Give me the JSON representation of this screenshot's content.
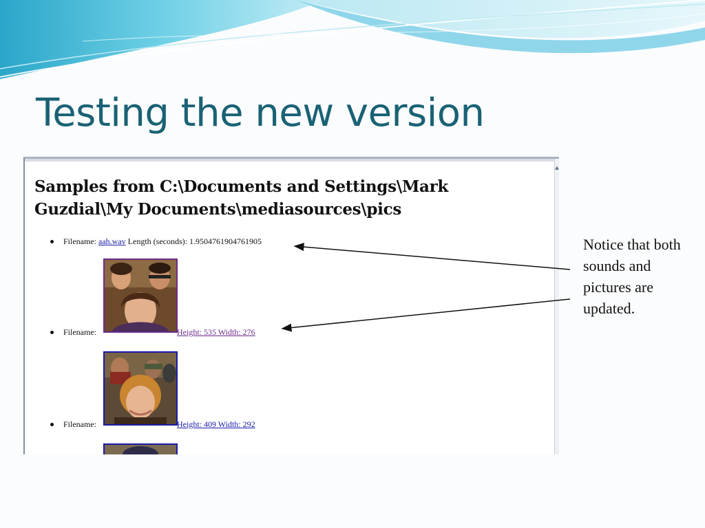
{
  "slide": {
    "title": "Testing the new version",
    "note": "Notice that both sounds and pictures are updated."
  },
  "browser_page": {
    "heading": "Samples from C:\\Documents and Settings\\Mark Guzdial\\My Documents\\mediasources\\pics",
    "entries": [
      {
        "label": "Filename:",
        "link_text": "aah.wav",
        "detail": "Length (seconds): 1.9504761904761905"
      },
      {
        "label": "Filename:",
        "link_text": "Height: 535 Width: 276",
        "image": "group-photo-thumbnail"
      },
      {
        "label": "Filename:",
        "link_text": "Height: 409 Width: 292",
        "image": "curly-hair-photo-thumbnail"
      },
      {
        "image": "partial-photo-thumbnail"
      }
    ]
  },
  "colors": {
    "title": "#1a6275",
    "link_unvisited": "#1a1aa8",
    "link_visited": "#6b2b8a"
  }
}
